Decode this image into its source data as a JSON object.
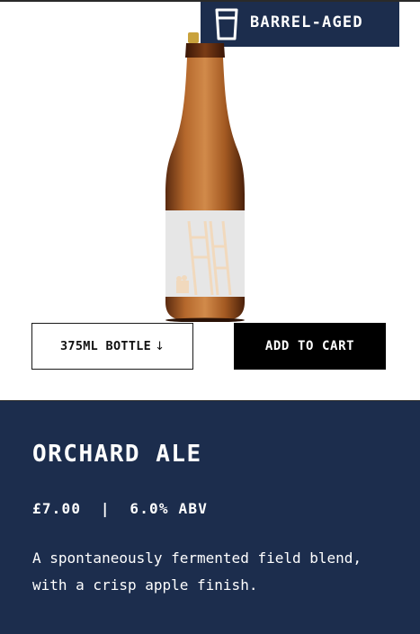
{
  "badge": {
    "label": "BARREL-AGED",
    "icon": "glass-icon"
  },
  "product": {
    "image_alt": "bottle-image",
    "name": "ORCHARD ALE",
    "price": "£7.00",
    "separator": "|",
    "abv": "6.0% ABV",
    "description": "A spontaneously fermented field blend, with a crisp apple finish."
  },
  "variant": {
    "selected": "375ML BOTTLE",
    "icon": "arrow-down-icon"
  },
  "actions": {
    "add_to_cart": "ADD TO CART"
  },
  "colors": {
    "navy": "#1c2d4d",
    "black": "#000000",
    "white": "#ffffff",
    "label_cream": "#f1d9bd"
  }
}
